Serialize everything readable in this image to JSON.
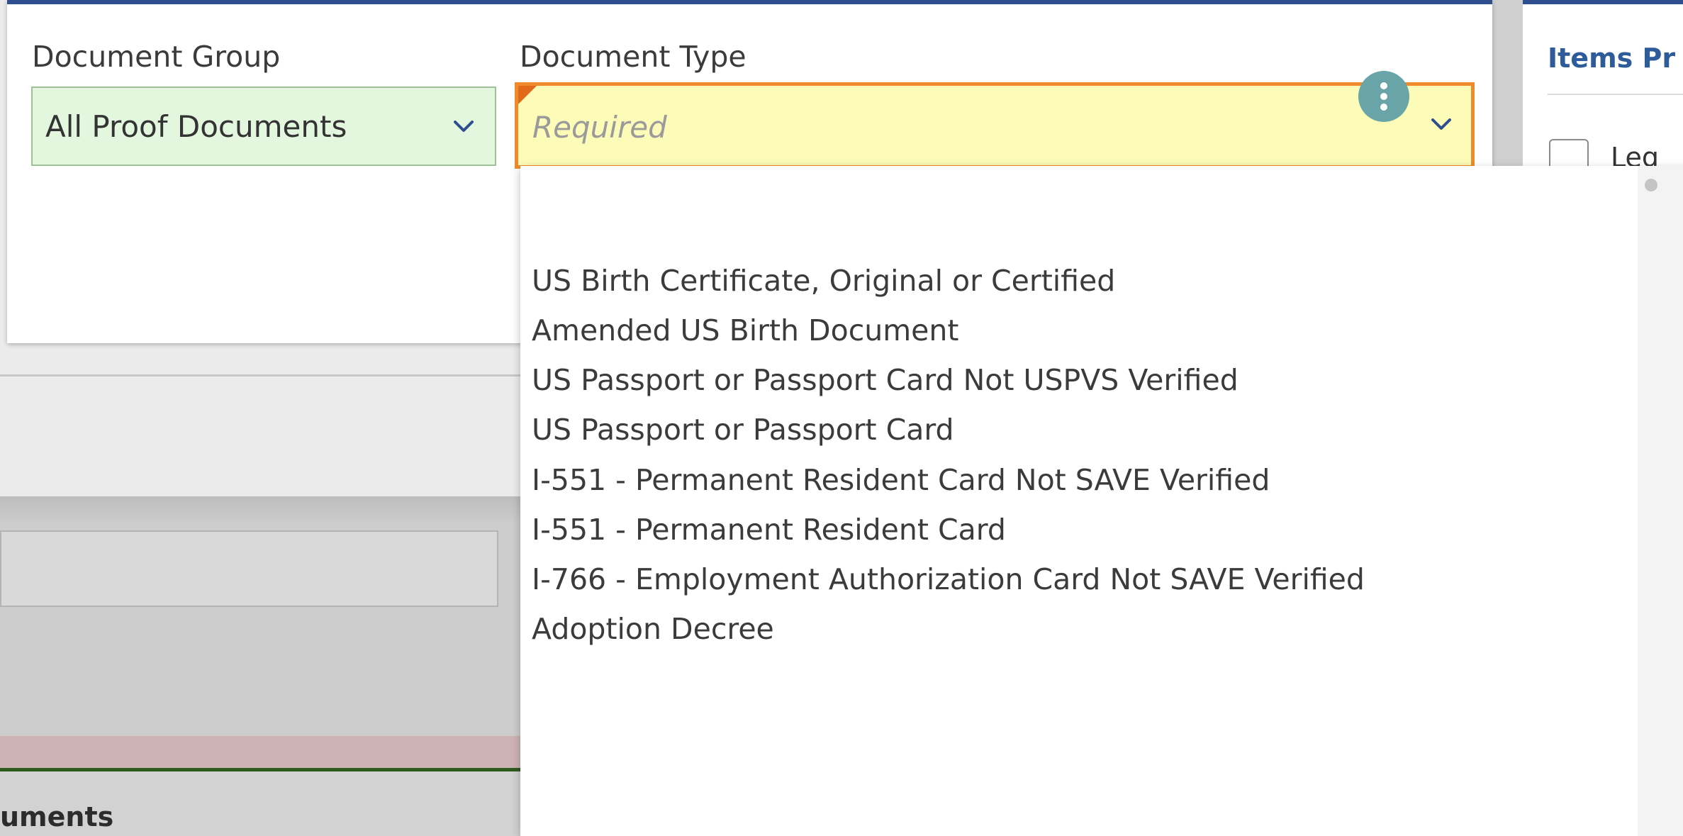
{
  "form": {
    "document_group_label": "Document Group",
    "document_group_value": "All Proof Documents",
    "document_type_label": "Document Type",
    "document_type_placeholder": "Required"
  },
  "dropdown": {
    "options": [
      "",
      "US Birth Certificate, Original or Certified",
      "Amended US Birth Document",
      "US Passport or Passport Card Not USPVS Verified",
      "US Passport or Passport Card",
      "I-551 - Permanent Resident Card Not SAVE Verified",
      "I-551 - Permanent Resident Card",
      "I-766 - Employment Authorization Card Not SAVE Verified",
      "Adoption Decree"
    ]
  },
  "right_panel": {
    "heading": "Items Pr",
    "checkbox_label": "Leg"
  },
  "background": {
    "section_label": "uments"
  },
  "colors": {
    "accent_blue": "#2e4e8f",
    "required_border": "#ef8b2a",
    "required_fill": "#fcfbb8",
    "valid_fill": "#e3f6de",
    "kebab": "#69a5a8"
  },
  "icons": [
    "chevron-down-icon",
    "more-vertical-icon"
  ]
}
